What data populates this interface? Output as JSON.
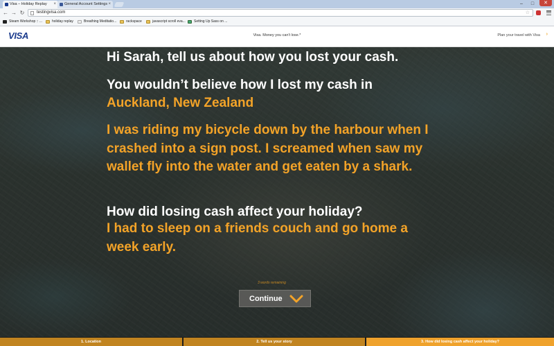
{
  "browser": {
    "tabs": [
      {
        "label": "Visa – Holiday Replay",
        "active": true,
        "favicon_color": "#1a3a8c"
      },
      {
        "label": "General Account Settings",
        "active": false,
        "favicon_color": "#3b5998"
      }
    ],
    "address": "testingvisa.com",
    "bookmarks": [
      {
        "label": "Steam Workshop :: ...",
        "icon": "steam-icon"
      },
      {
        "label": "holiday replay",
        "icon": "folder-icon"
      },
      {
        "label": "Breathing Meditatio...",
        "icon": "page-icon"
      },
      {
        "label": "rackspace",
        "icon": "folder-icon"
      },
      {
        "label": "javascript scroll eva...",
        "icon": "folder-icon"
      },
      {
        "label": "Setting Up Sass on ...",
        "icon": "page-icon"
      }
    ]
  },
  "header": {
    "logo": "VISA",
    "tagline": "Visa. Money you can't lose.*",
    "plan_link": "Plan your travel with Visa",
    "plan_arrow": "›"
  },
  "story": {
    "question1": "Hi Sarah, tell us about how you lost your cash.",
    "answer1_prefix": "You wouldn’t believe how I lost my cash in",
    "answer1_location": "Auckland, New Zealand",
    "answer1_story": "I was riding my bicycle down by the harbour when I crashed into a sign post. I screamed when saw my wallet fly into the water and get eaten by a shark.",
    "question2": "How did losing cash affect your holiday?",
    "answer2": "I had to sleep on a friends couch and go home a week early."
  },
  "hint": "3 words remaining",
  "continue_label": "Continue",
  "steps": [
    {
      "label": "1. Location"
    },
    {
      "label": "2. Tell us your story"
    },
    {
      "label": "3. How did losing cash affect your holiday?"
    }
  ],
  "colors": {
    "accent": "#f3a328",
    "step_active": "#efa22c",
    "step_inactive": "#c18420",
    "brand_blue": "#1a3a8c"
  }
}
